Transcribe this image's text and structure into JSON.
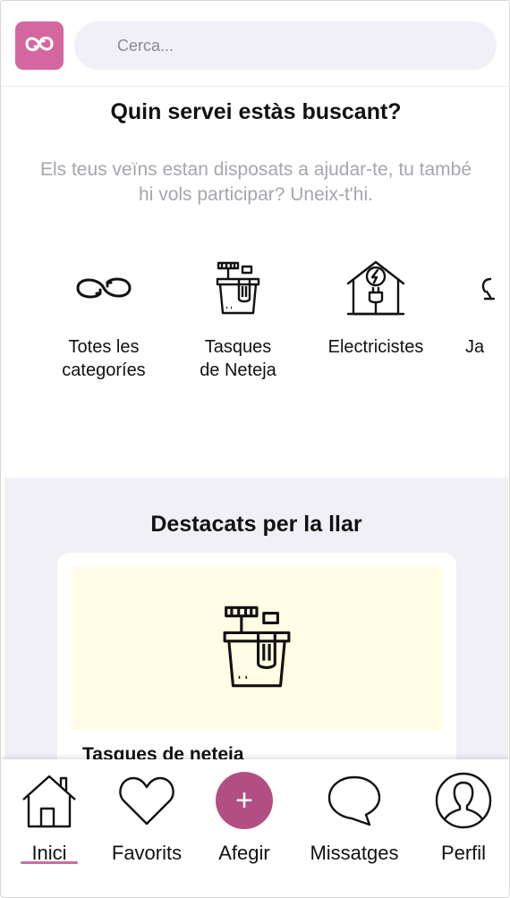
{
  "brand": {
    "accent": "#d4679f",
    "logo_icon": "swap-arrows-icon"
  },
  "search": {
    "placeholder": "Cerca...",
    "value": ""
  },
  "services": {
    "title": "Quin servei estàs buscant?",
    "subtitle": "Els teus veïns estan disposats a ajudar-te, tu també hi vols participar? Uneix-t'hi.",
    "categories": [
      {
        "label": "Totes les\ncategoríes",
        "icon": "infinity-arrows-icon"
      },
      {
        "label": "Tasques\nde Neteja",
        "icon": "cleaning-bucket-icon"
      },
      {
        "label": "Electricistes",
        "icon": "electric-house-icon"
      },
      {
        "label": "Ja",
        "icon": "garden-icon"
      }
    ]
  },
  "featured": {
    "title": "Destacats per la llar",
    "background": "#f1f0f7",
    "card": {
      "title": "Tasques de neteja",
      "media_color": "#fffde3",
      "icon": "cleaning-bucket-icon"
    }
  },
  "bottom_nav": {
    "items": [
      {
        "label": "Inici",
        "icon": "home-icon",
        "active": true
      },
      {
        "label": "Favorits",
        "icon": "heart-icon",
        "active": false
      },
      {
        "label": "Afegir",
        "icon": "plus-icon",
        "active": false
      },
      {
        "label": "Missatges",
        "icon": "chat-bubble-icon",
        "active": false
      },
      {
        "label": "Perfil",
        "icon": "user-icon",
        "active": false
      }
    ],
    "active_color": "#c66fa2",
    "add_button_color": "#b24f82"
  }
}
